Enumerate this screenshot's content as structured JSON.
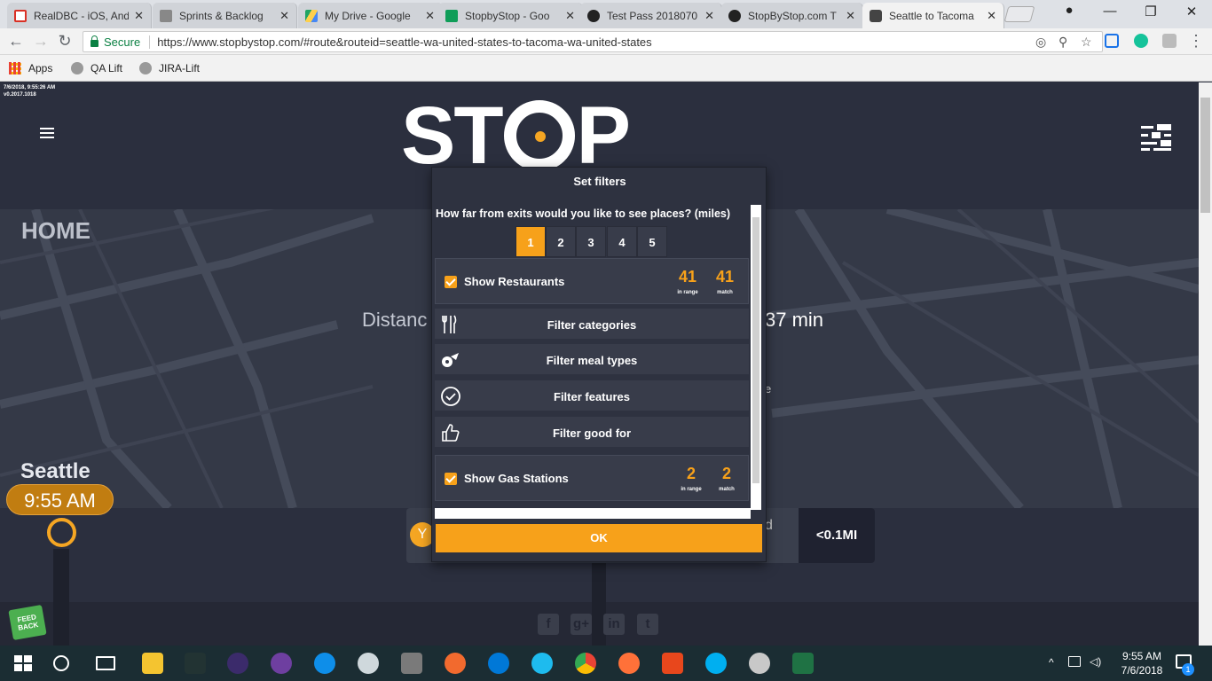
{
  "browser": {
    "tabs": [
      {
        "title": "RealDBC - iOS, And",
        "icon": "gmail-icon",
        "color": "#d93025"
      },
      {
        "title": "Sprints & Backlog",
        "icon": "jira-icon",
        "color": "#555555"
      },
      {
        "title": "My Drive - Google",
        "icon": "drive-icon",
        "color": "#1fa463"
      },
      {
        "title": "StopbyStop - Goo",
        "icon": "sheets-icon",
        "color": "#0f9d58"
      },
      {
        "title": "Test Pass 2018070",
        "icon": "github-icon",
        "color": "#222222"
      },
      {
        "title": "StopByStop.com T",
        "icon": "github-icon",
        "color": "#222222"
      },
      {
        "title": "Seattle to Tacoma",
        "icon": "stopbystop-icon",
        "color": "#444444"
      }
    ],
    "secure_label": "Secure",
    "url": "https://www.stopbystop.com/#route&routeid=seattle-wa-united-states-to-tacoma-wa-united-states",
    "bookmarks": [
      {
        "label": "Apps"
      },
      {
        "label": "QA Lift"
      },
      {
        "label": "JIRA-Lift"
      }
    ]
  },
  "page": {
    "debug_time": "7/6/2018, 9:55:26 AM",
    "debug_version": "v0.2017.1018",
    "logo_left": "ST",
    "logo_right": "P",
    "home_label": "HOME",
    "distance_partial": "Distanc",
    "duration_partial": "37 min",
    "stray_e": "e",
    "city": "Seattle",
    "time": "9:55 AM",
    "card_partial": "d",
    "miles": "<0.1MI",
    "feedback": "FEED BACK",
    "social": [
      "f",
      "g+",
      "in",
      "t"
    ]
  },
  "modal": {
    "title": "Set filters",
    "question": "How far from exits would you like to see places? (miles)",
    "distances": [
      "1",
      "2",
      "3",
      "4",
      "5"
    ],
    "selected_distance": "1",
    "restaurants": {
      "label": "Show Restaurants",
      "in_range": "41",
      "in_range_label": "in range",
      "match": "41",
      "match_label": "match"
    },
    "filters": [
      {
        "label": "Filter categories",
        "icon": "fork-knife-icon"
      },
      {
        "label": "Filter meal types",
        "icon": "meal-icon"
      },
      {
        "label": "Filter features",
        "icon": "check-circle-icon"
      },
      {
        "label": "Filter good for",
        "icon": "thumbs-up-icon"
      }
    ],
    "gas": {
      "label": "Show Gas Stations",
      "in_range": "2",
      "in_range_label": "in range",
      "match": "2",
      "match_label": "match"
    },
    "ok_label": "OK"
  },
  "taskbar": {
    "time": "9:55 AM",
    "date": "7/6/2018",
    "notification_count": "1"
  },
  "colors": {
    "accent": "#f7a11a",
    "bg": "#2b2f3e"
  }
}
